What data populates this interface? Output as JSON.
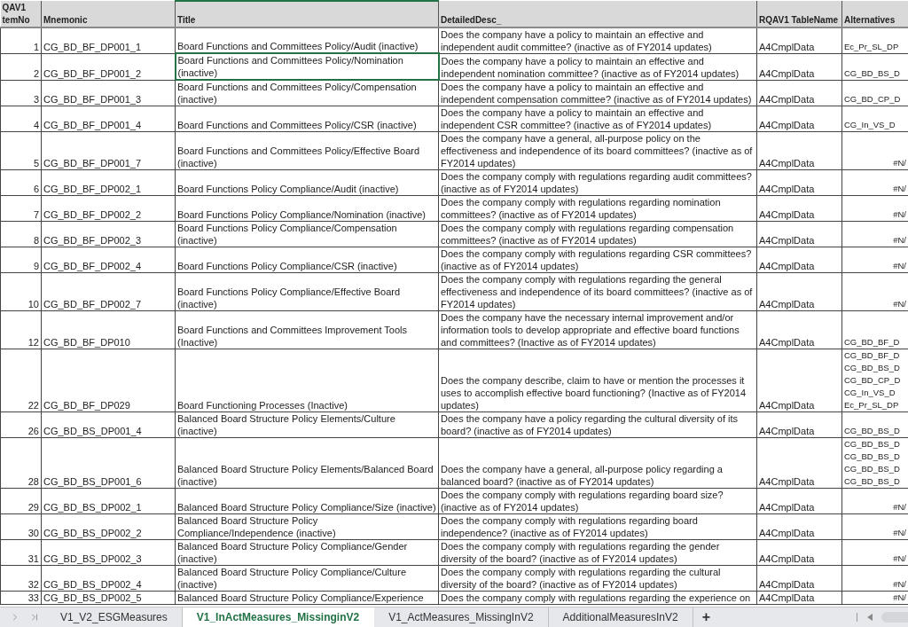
{
  "sheet": {
    "columns": [
      {
        "label": "QAV1 temNo",
        "selected": false
      },
      {
        "label": "Mnemonic",
        "selected": false
      },
      {
        "label": "Title",
        "selected": true
      },
      {
        "label": "DetailedDesc_",
        "selected": false
      },
      {
        "label": "RQAV1 TableName",
        "selected": false
      },
      {
        "label": "Alternatives",
        "selected": false
      }
    ],
    "rows": [
      {
        "item_no": "1",
        "mnemonic": "CG_BD_BF_DP001_1",
        "title": "Board Functions and Committees Policy/Audit (inactive)",
        "description": "Does the company have a policy to maintain an effective and independent audit committee? (inactive as of FY2014 updates)",
        "table_name": "A4CmplData",
        "alternatives": [
          {
            "kind": "code",
            "text": "Ec_Pr_SL_DP"
          }
        ],
        "selected": false
      },
      {
        "item_no": "2",
        "mnemonic": "CG_BD_BF_DP001_2",
        "title": "Board Functions and Committees Policy/Nomination (inactive)",
        "description": "Does the company have a policy to maintain an effective and independent nomination committee? (inactive as of FY2014 updates)",
        "table_name": "A4CmplData",
        "alternatives": [
          {
            "kind": "code",
            "text": "CG_BD_BS_D"
          }
        ],
        "selected": true
      },
      {
        "item_no": "3",
        "mnemonic": "CG_BD_BF_DP001_3",
        "title": "Board Functions and Committees Policy/Compensation (inactive)",
        "description": "Does the company have a policy to maintain an effective and independent compensation committee? (inactive as of FY2014 updates)",
        "table_name": "A4CmplData",
        "alternatives": [
          {
            "kind": "code",
            "text": "CG_BD_CP_D"
          }
        ],
        "selected": false
      },
      {
        "item_no": "4",
        "mnemonic": "CG_BD_BF_DP001_4",
        "title": "Board Functions and Committees Policy/CSR (inactive)",
        "description": "Does the company have a policy to maintain an effective and independent CSR committee? (inactive as of FY2014 updates)",
        "table_name": "A4CmplData",
        "alternatives": [
          {
            "kind": "code",
            "text": "CG_In_VS_D"
          }
        ],
        "selected": false
      },
      {
        "item_no": "5",
        "mnemonic": "CG_BD_BF_DP001_7",
        "title": "Board Functions and Committees Policy/Effective Board (inactive)",
        "description": "Does the company have a general, all-purpose policy on the effectiveness and independence of its board committees? (inactive as of FY2014 updates)",
        "table_name": "A4CmplData",
        "alternatives": [
          {
            "kind": "error",
            "text": "#N/"
          }
        ],
        "selected": false
      },
      {
        "item_no": "6",
        "mnemonic": "CG_BD_BF_DP002_1",
        "title": "Board Functions Policy Compliance/Audit (inactive)",
        "description": "Does the company comply with regulations regarding audit committees? (inactive as of FY2014 updates)",
        "table_name": "A4CmplData",
        "alternatives": [
          {
            "kind": "error",
            "text": "#N/"
          }
        ],
        "selected": false
      },
      {
        "item_no": "7",
        "mnemonic": "CG_BD_BF_DP002_2",
        "title": "Board Functions Policy Compliance/Nomination (inactive)",
        "description": "Does the company comply with regulations regarding nomination committees? (inactive as of FY2014 updates)",
        "table_name": "A4CmplData",
        "alternatives": [
          {
            "kind": "error",
            "text": "#N/"
          }
        ],
        "selected": false
      },
      {
        "item_no": "8",
        "mnemonic": "CG_BD_BF_DP002_3",
        "title": "Board Functions Policy Compliance/Compensation (inactive)",
        "description": "Does the company comply with regulations regarding compensation committees? (inactive as of FY2014 updates)",
        "table_name": "A4CmplData",
        "alternatives": [
          {
            "kind": "error",
            "text": "#N/"
          }
        ],
        "selected": false
      },
      {
        "item_no": "9",
        "mnemonic": "CG_BD_BF_DP002_4",
        "title": "Board Functions Policy Compliance/CSR (inactive)",
        "description": "Does the company comply with regulations regarding CSR committees? (inactive as of FY2014 updates)",
        "table_name": "A4CmplData",
        "alternatives": [
          {
            "kind": "error",
            "text": "#N/"
          }
        ],
        "selected": false
      },
      {
        "item_no": "10",
        "mnemonic": "CG_BD_BF_DP002_7",
        "title": "Board Functions Policy Compliance/Effective Board (inactive)",
        "description": "Does the company comply with regulations regarding the general effectiveness and independence of its board committees? (inactive as of FY2014 updates)",
        "table_name": "A4CmplData",
        "alternatives": [
          {
            "kind": "error",
            "text": "#N/"
          }
        ],
        "selected": false
      },
      {
        "item_no": "12",
        "mnemonic": "CG_BD_BF_DP010",
        "title": "Board Functions and Committees Improvement Tools (Inactive)",
        "description": "Does the company have the necessary internal improvement and/or information tools to develop appropriate and effective board functions and committees? (Inactive as of FY2014 updates)",
        "table_name": "A4CmplData",
        "alternatives": [
          {
            "kind": "code",
            "text": "CG_BD_BF_D"
          }
        ],
        "selected": false
      },
      {
        "item_no": "22",
        "mnemonic": "CG_BD_BF_DP029",
        "title": "Board Functioning Processes (Inactive)",
        "description": "Does the company describe, claim to have or mention the processes it uses to accomplish effective board functioning? (Inactive as of FY2014 updates)",
        "table_name": "A4CmplData",
        "alternatives": [
          {
            "kind": "code",
            "text": "CG_BD_BF_D"
          },
          {
            "kind": "code",
            "text": "CG_BD_BS_D"
          },
          {
            "kind": "code",
            "text": "CG_BD_CP_D"
          },
          {
            "kind": "code",
            "text": "CG_In_VS_D"
          },
          {
            "kind": "code",
            "text": "Ec_Pr_SL_DP"
          }
        ],
        "selected": false
      },
      {
        "item_no": "26",
        "mnemonic": "CG_BD_BS_DP001_4",
        "title": "Balanced Board Structure Policy Elements/Culture (inactive)",
        "description": "Does the company have a policy regarding the cultural diversity of its board? (inactive as of FY2014 updates)",
        "table_name": "A4CmplData",
        "alternatives": [
          {
            "kind": "code",
            "text": "CG_BD_BS_D"
          }
        ],
        "selected": false
      },
      {
        "item_no": "28",
        "mnemonic": "CG_BD_BS_DP001_6",
        "title": "Balanced Board Structure Policy Elements/Balanced Board (inactive)",
        "description": "Does the company have a general, all-purpose policy regarding a balanced board? (inactive as of FY2014 updates)",
        "table_name": "A4CmplData",
        "alternatives": [
          {
            "kind": "code",
            "text": "CG_BD_BS_D"
          },
          {
            "kind": "code",
            "text": "CG_BD_BS_D"
          },
          {
            "kind": "code",
            "text": "CG_BD_BS_D"
          },
          {
            "kind": "code",
            "text": "CG_BD_BS_D"
          }
        ],
        "selected": false
      },
      {
        "item_no": "29",
        "mnemonic": "CG_BD_BS_DP002_1",
        "title": "Balanced Board Structure Policy Compliance/Size (inactive)",
        "description": "Does the company comply with regulations regarding board size? (inactive as of FY2014 updates)",
        "table_name": "A4CmplData",
        "alternatives": [
          {
            "kind": "error",
            "text": "#N/"
          }
        ],
        "selected": false
      },
      {
        "item_no": "30",
        "mnemonic": "CG_BD_BS_DP002_2",
        "title": "Balanced Board Structure Policy Compliance/Independence (inactive)",
        "description": "Does the company comply with regulations regarding board independence? (inactive as of FY2014 updates)",
        "table_name": "A4CmplData",
        "alternatives": [
          {
            "kind": "error",
            "text": "#N/"
          }
        ],
        "selected": false
      },
      {
        "item_no": "31",
        "mnemonic": "CG_BD_BS_DP002_3",
        "title": "Balanced Board Structure Policy Compliance/Gender (inactive)",
        "description": "Does the company comply with regulations regarding the gender diversity of the board? (inactive as of FY2014 updates)",
        "table_name": "A4CmplData",
        "alternatives": [
          {
            "kind": "error",
            "text": "#N/"
          }
        ],
        "selected": false
      },
      {
        "item_no": "32",
        "mnemonic": "CG_BD_BS_DP002_4",
        "title": "Balanced Board Structure Policy Compliance/Culture (inactive)",
        "description": "Does the company comply with regulations regarding the cultural diversity of the board? (inactive as of FY2014 updates)",
        "table_name": "A4CmplData",
        "alternatives": [
          {
            "kind": "error",
            "text": "#N/"
          }
        ],
        "selected": false
      },
      {
        "item_no": "33",
        "mnemonic": "CG_BD_BS_DP002_5",
        "title": "Balanced Board Structure Policy Compliance/Experience",
        "description": "Does the company comply with regulations regarding the experience on",
        "table_name": "A4CmplData",
        "alternatives": [
          {
            "kind": "error",
            "text": "#N/"
          }
        ],
        "selected": false
      }
    ]
  },
  "sheet_tabs": {
    "tabs": [
      {
        "label": "V1_V2_ESGMeasures",
        "selected": false
      },
      {
        "label": "V1_InActMeasures_MissinginV2",
        "selected": true
      },
      {
        "label": "V1_ActMeasures_MissingInV2",
        "selected": false
      },
      {
        "label": "AdditionalMeasuresInV2",
        "selected": false
      }
    ],
    "add_label": "+"
  }
}
